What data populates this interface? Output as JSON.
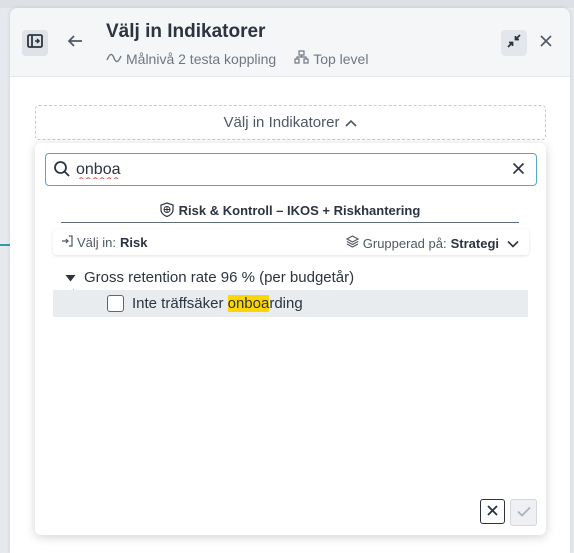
{
  "header": {
    "title": "Välj in Indikatorer",
    "subtitle_item": "Målnivå 2 testa koppling",
    "subtitle_level": "Top level"
  },
  "selector": {
    "label": "Välj in Indikatorer"
  },
  "search": {
    "value": "onboa"
  },
  "source": {
    "label": "Risk & Kontroll – IKOS + Riskhantering"
  },
  "filter": {
    "select_in_label": "Välj in:",
    "select_in_value": "Risk",
    "grouped_label": "Grupperad på:",
    "grouped_value": "Strategi"
  },
  "tree": {
    "group_label": "Gross retention rate 96 % (per budgetår)",
    "item_prefix": "Inte träffsäker ",
    "item_match": "onboa",
    "item_suffix": "rding",
    "item_checked": false
  },
  "colors": {
    "accent": "#5aa6c8",
    "highlight": "#ffd500",
    "text": "#2b3440"
  },
  "icons": [
    "sidebar-toggle-icon",
    "arrow-left-icon",
    "wave-icon",
    "hierarchy-icon",
    "collapse-icon",
    "close-icon",
    "chevron-up-icon",
    "search-icon",
    "clear-icon",
    "globe-shield-icon",
    "sign-in-icon",
    "layers-icon",
    "chevron-down-icon",
    "caret-down-icon",
    "x-icon",
    "check-icon"
  ]
}
